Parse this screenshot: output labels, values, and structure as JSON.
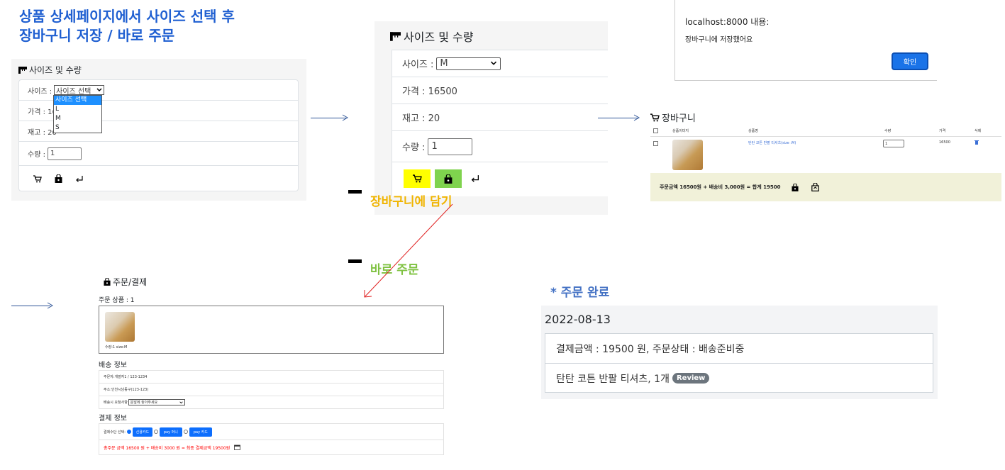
{
  "heading": {
    "line1": "상품 상세페이지에서 사이즈 선택 후",
    "line2": "장바구니 저장 / 바로 주문"
  },
  "panel1": {
    "title": "사이즈 및 수량",
    "size_label": "사이즈 :",
    "size_selected": "사이즈 선택",
    "size_options": [
      "사이즈 선택",
      "L",
      "M",
      "S"
    ],
    "price_label": "가격 : 16",
    "stock_label": "재고 : 20",
    "qty_label": "수량 :",
    "qty_value": "1"
  },
  "panel2": {
    "title": "사이즈 및 수량",
    "size_label": "사이즈 :",
    "size_selected": "M",
    "price_label": "가격 : 16500",
    "stock_label": "재고 : 20",
    "qty_label": "수량 :",
    "qty_value": "1"
  },
  "annotations": {
    "add_cart": "장바구니에 담기",
    "buy_now": "바로 주문",
    "order_done": "* 주문 완료"
  },
  "alert": {
    "title": "localhost:8000 내용:",
    "message": "장바구니에 저장했어요",
    "ok": "확인"
  },
  "cart": {
    "title": "장바구니",
    "columns": [
      "상품이미지",
      "상품명",
      "수량",
      "가격",
      "삭제"
    ],
    "item_name": "탄탄 코튼 반팔 티셔츠(size :M)",
    "item_qty": "1",
    "item_price": "16500",
    "total_text": "주문금액 16500원 + 배송비 3,000원 = 합계 19500"
  },
  "checkout": {
    "title": "주문/결제",
    "order_items": "주문 상품 : 1",
    "item_caption": "수량:1 size:M",
    "shipping_title": "배송 정보",
    "orderer": "주문자:개발자1 / 123-1234",
    "address": "주소:인천시남동구(123-123)",
    "request_label": "배송시 요청사항",
    "request_value": "문앞에 놓아주세요",
    "payment_title": "결제 정보",
    "method_label": "결제수단 선택:",
    "methods": [
      "신용카드",
      "pay 머니",
      "pay 카드"
    ],
    "total_text": "총주문 금액 16500 원 + 배송비 3000 원 = 최종 결제금액 19500원"
  },
  "order_done": {
    "date": "2022-08-13",
    "summary": "결제금액 : 19500 원, 주문상태 : 배송준비중",
    "item": "탄탄 코튼 반팔 티셔츠, 1개",
    "review": "Review"
  },
  "colors": {
    "heading": "#1f5fd1",
    "add_cart_label": "#f0b400",
    "buy_now_label": "#7fc241",
    "cart_button": "#ffff00",
    "buy_button": "#7fd34e",
    "cart_total_bg": "#f1f1d9",
    "pay_blue": "#0d6efd",
    "total_red": "#ff0000"
  },
  "icons": {
    "ruler": "ruler-icon",
    "cart": "cart-icon",
    "bag": "bag-icon",
    "return": "return-arrow-icon",
    "trash": "trash-icon"
  }
}
